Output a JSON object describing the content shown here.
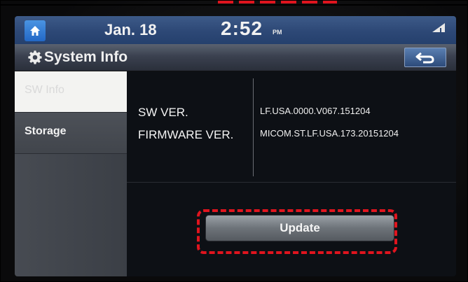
{
  "status_bar": {
    "date": "Jan. 18",
    "time": "2:52",
    "period": "PM",
    "icons": {
      "home": "home-icon",
      "signal": "signal-icon"
    }
  },
  "header": {
    "title": "System Info",
    "icons": {
      "title": "gear-icon",
      "back": "back-arrow-icon"
    }
  },
  "sidebar": {
    "items": [
      {
        "label": "SW Info",
        "active": true
      },
      {
        "label": "Storage",
        "active": false
      }
    ]
  },
  "info": {
    "rows": [
      {
        "key": "SW VER.",
        "value": "LF.USA.0000.V067.151204"
      },
      {
        "key": "FIRMWARE VER.",
        "value": "MICOM.ST.LF.USA.173.20151204"
      }
    ]
  },
  "actions": {
    "update_label": "Update"
  },
  "colors": {
    "highlight": "#e0141e",
    "topbar": "#2d4876",
    "home_button": "#2f7bd6"
  }
}
